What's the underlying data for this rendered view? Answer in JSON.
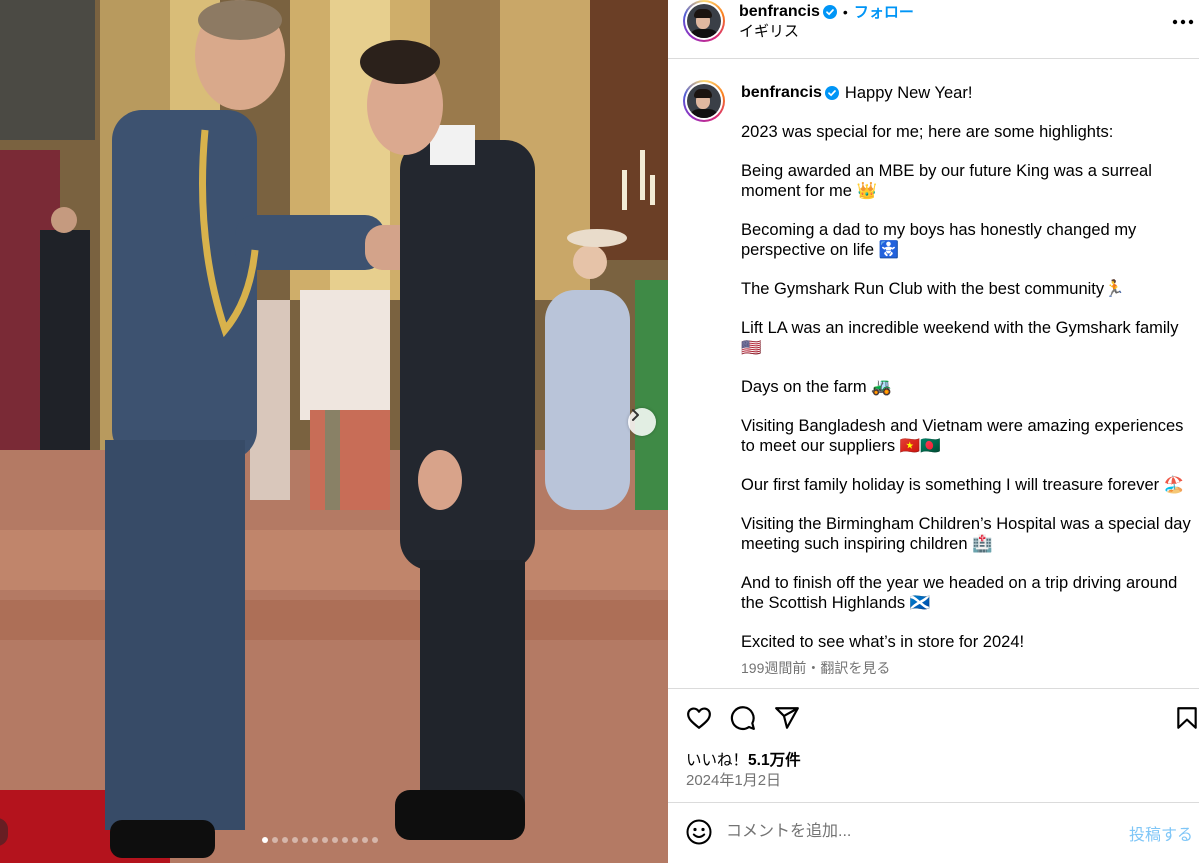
{
  "post": {
    "username": "benfrancis",
    "separator": "•",
    "follow_label": "フォロー",
    "location": "イギリス"
  },
  "caption": {
    "username": "benfrancis",
    "first_line": "Happy New Year!",
    "paragraphs": [
      "2023 was special for me; here are some highlights:",
      "Being awarded an MBE by our future King was a surreal moment for me 👑",
      "Becoming a dad to my boys has honestly changed my perspective on life 🚼",
      "The Gymshark Run Club with the best community🏃",
      "Lift LA was an incredible weekend with the Gymshark family🇺🇸",
      "Days on the farm 🚜",
      "Visiting Bangladesh and Vietnam were amazing experiences to meet our suppliers 🇻🇳🇧🇩",
      "Our first family holiday is something I will treasure forever 🏖️",
      "Visiting the Birmingham Children’s Hospital was a special day meeting such inspiring children 🏥",
      "And to finish off the year we headed on a trip driving around the Scottish Highlands 🏴󠁧󠁢󠁳󠁣󠁴󠁿",
      "Excited to see what’s in store for 2024!"
    ],
    "translate_label": "199週間前・翻訳を見る"
  },
  "stats": {
    "likes_prefix": "いいね！",
    "likes_count": "5.1万件",
    "date": "2024年1月2日"
  },
  "comment": {
    "placeholder": "コメントを追加...",
    "post_label": "投稿する"
  },
  "carousel": {
    "slide_count": 12,
    "active_index": 0
  },
  "icons": {
    "verified": "verified-badge-icon",
    "more": "more-options-icon",
    "like": "heart-icon",
    "comment": "comment-icon",
    "share": "share-icon",
    "save": "bookmark-icon",
    "emoji": "emoji-icon",
    "next": "chevron-right-icon"
  },
  "colors": {
    "accent": "#0095f6",
    "post_disabled": "#7fc6f7",
    "secondary_text": "#737373",
    "border": "#dbdbdb",
    "verified": "#0095f6"
  }
}
